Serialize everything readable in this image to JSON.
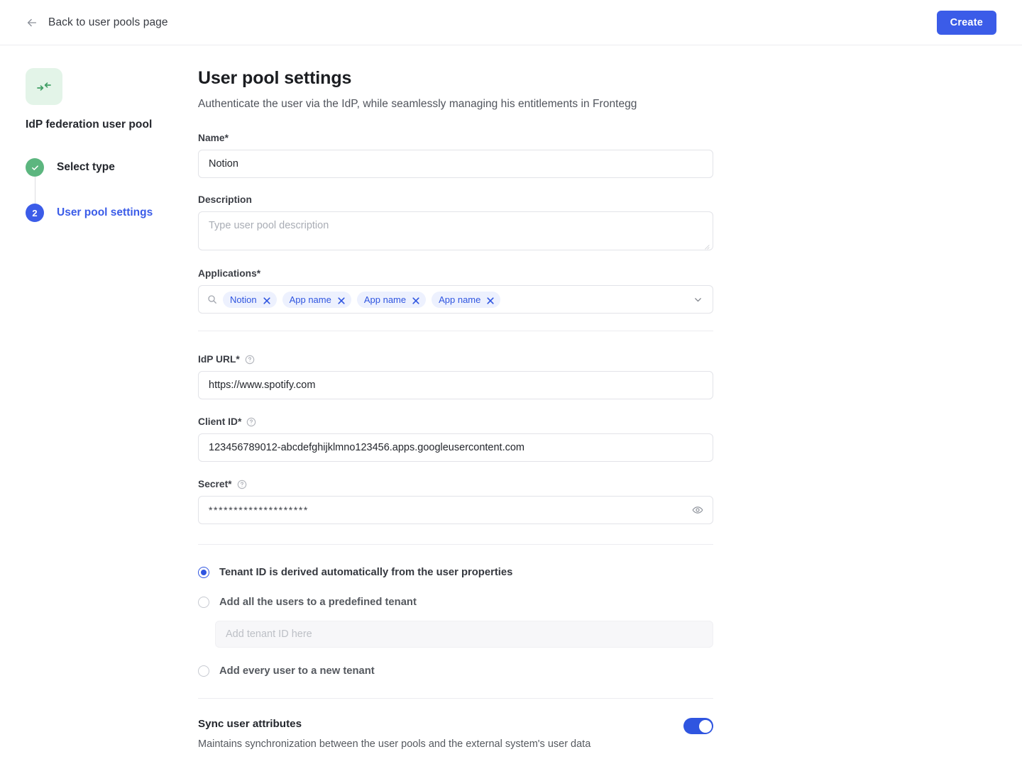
{
  "header": {
    "back_label": "Back to user pools page",
    "create_label": "Create"
  },
  "sidebar": {
    "pool_title": "IdP federation user pool",
    "steps": [
      {
        "label": "Select type",
        "state": "done",
        "marker": "✓"
      },
      {
        "label": "User pool settings",
        "state": "current",
        "marker": "2"
      }
    ]
  },
  "main": {
    "title": "User pool settings",
    "subtitle": "Authenticate the user via the IdP, while seamlessly managing his entitlements in Frontegg",
    "name": {
      "label": "Name*",
      "value": "Notion"
    },
    "description": {
      "label": "Description",
      "value": "",
      "placeholder": "Type user pool description"
    },
    "applications": {
      "label": "Applications*",
      "chips": [
        "Notion",
        "App name",
        "App name",
        "App name"
      ]
    },
    "idp_url": {
      "label": "IdP URL*",
      "value": "https://www.spotify.com"
    },
    "client_id": {
      "label": "Client ID*",
      "value": "123456789012-abcdefghijklmno123456.apps.googleusercontent.com"
    },
    "secret": {
      "label": "Secret*",
      "value": "********************"
    },
    "tenant_options": [
      {
        "label": "Tenant ID is derived automatically from the user properties",
        "selected": true
      },
      {
        "label": "Add all the users to a predefined tenant",
        "selected": false
      },
      {
        "label": "Add every user to a new tenant",
        "selected": false
      }
    ],
    "tenant_input": {
      "value": "",
      "placeholder": "Add tenant ID here"
    },
    "sync": {
      "title": "Sync user attributes",
      "description": "Maintains synchronization between the user pools and the external system's user data",
      "enabled": true
    }
  },
  "colors": {
    "accent": "#3b5ce8",
    "chip_text": "#2f55e0",
    "chip_bg": "#edf1fe",
    "step_done": "#5cb67f",
    "icon_bg": "#e3f4e8",
    "icon_fg": "#3f9e64"
  }
}
